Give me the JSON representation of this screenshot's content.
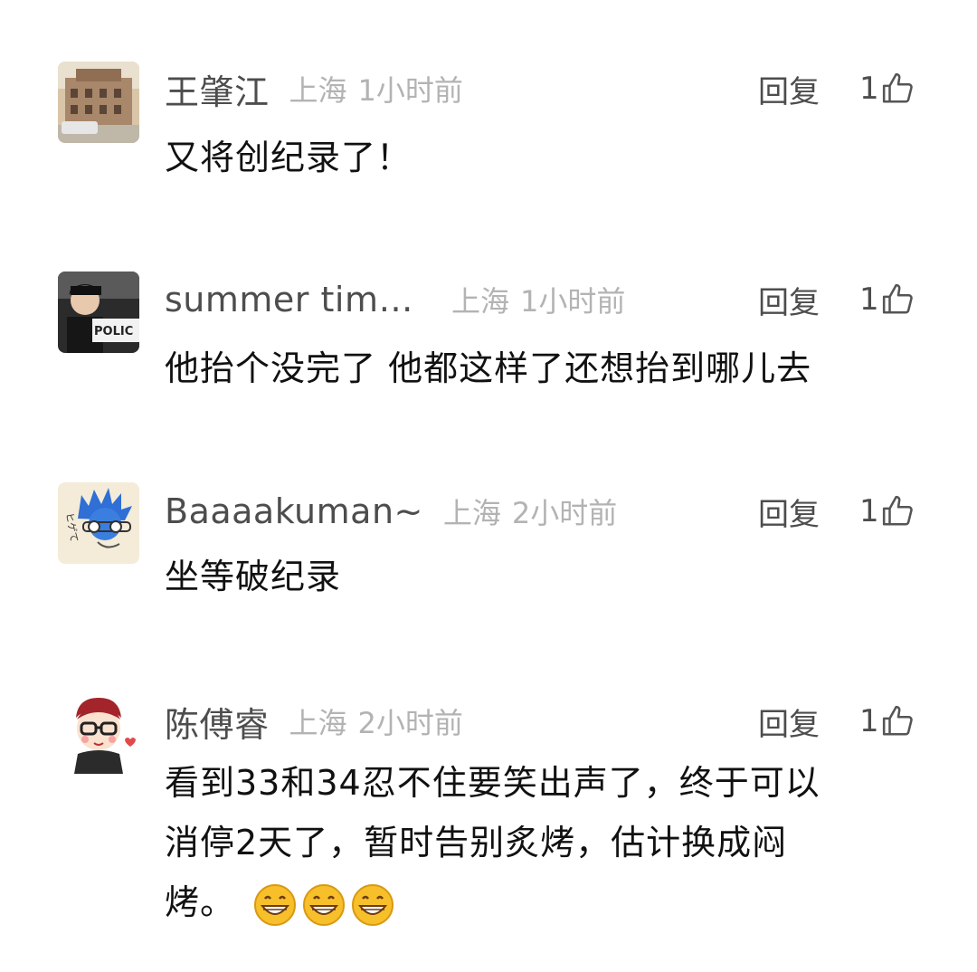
{
  "comments": [
    {
      "username": "王肇江",
      "location": "上海",
      "time": "1小时前",
      "reply_label": "回复",
      "likes": "1",
      "text": "又将创纪录了！",
      "avatar": "building-photo-avatar"
    },
    {
      "username": "summer tim…",
      "location": "上海",
      "time": "1小时前",
      "reply_label": "回复",
      "likes": "1",
      "text": "他抬个没完了 他都这样了还想抬到哪儿去",
      "avatar": "police-photo-avatar",
      "avatar_text": "POLIC"
    },
    {
      "username": "Baaaakuman~",
      "location": "上海",
      "time": "2小时前",
      "reply_label": "回复",
      "likes": "1",
      "text": "坐等破纪录",
      "avatar": "cartoon-blue-hair-avatar",
      "avatar_text": "ヒゲて"
    },
    {
      "username": "陈傅睿",
      "location": "上海",
      "time": "2小时前",
      "reply_label": "回复",
      "likes": "1",
      "text_lines": [
        "看到33和34忍不住要笑出声了，终于可以",
        "消停2天了，暂时告别炙烤，估计换成闷",
        "烤。"
      ],
      "emojis": [
        "grin-emoji",
        "grin-emoji",
        "grin-emoji"
      ],
      "avatar": "cartoon-boy-glasses-avatar"
    }
  ],
  "colors": {
    "username": "#4d4d4d",
    "meta": "#b3b3b3",
    "text": "#111111",
    "icon": "#555555",
    "emoji": "#f7c02b"
  }
}
